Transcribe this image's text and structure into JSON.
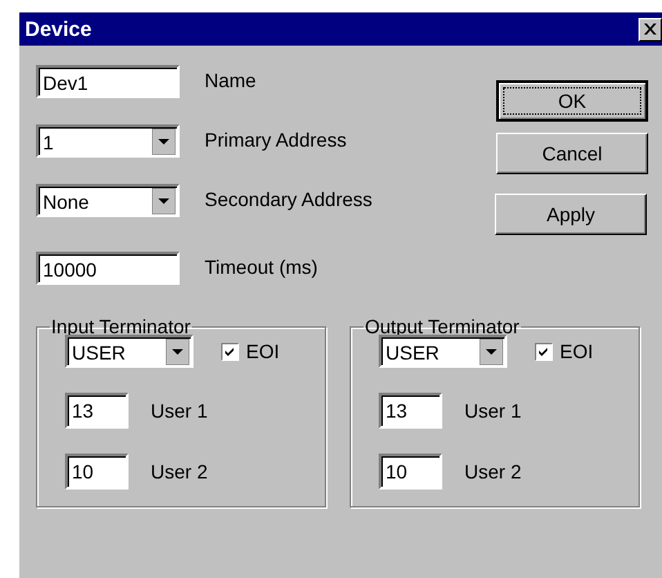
{
  "window": {
    "title": "Device"
  },
  "fields": [
    {
      "kind": "text",
      "value": "Dev1",
      "label": "Name"
    },
    {
      "kind": "dropdown",
      "value": "1",
      "label": "Primary Address"
    },
    {
      "kind": "dropdown",
      "value": "None",
      "label": "Secondary Address"
    },
    {
      "kind": "text",
      "value": "10000",
      "label": "Timeout (ms)"
    }
  ],
  "buttons": [
    {
      "label": "OK",
      "default": true
    },
    {
      "label": "Cancel",
      "default": false
    },
    {
      "label": "Apply",
      "default": false
    }
  ],
  "terminators": [
    {
      "title": "Input Terminator",
      "mode": "USER",
      "eoi": {
        "label": "EOI",
        "checked": true
      },
      "users": [
        {
          "value": "13",
          "label": "User 1"
        },
        {
          "value": "10",
          "label": "User 2"
        }
      ]
    },
    {
      "title": "Output Terminator",
      "mode": "USER",
      "eoi": {
        "label": "EOI",
        "checked": true
      },
      "users": [
        {
          "value": "13",
          "label": "User 1"
        },
        {
          "value": "10",
          "label": "User 2"
        }
      ]
    }
  ]
}
